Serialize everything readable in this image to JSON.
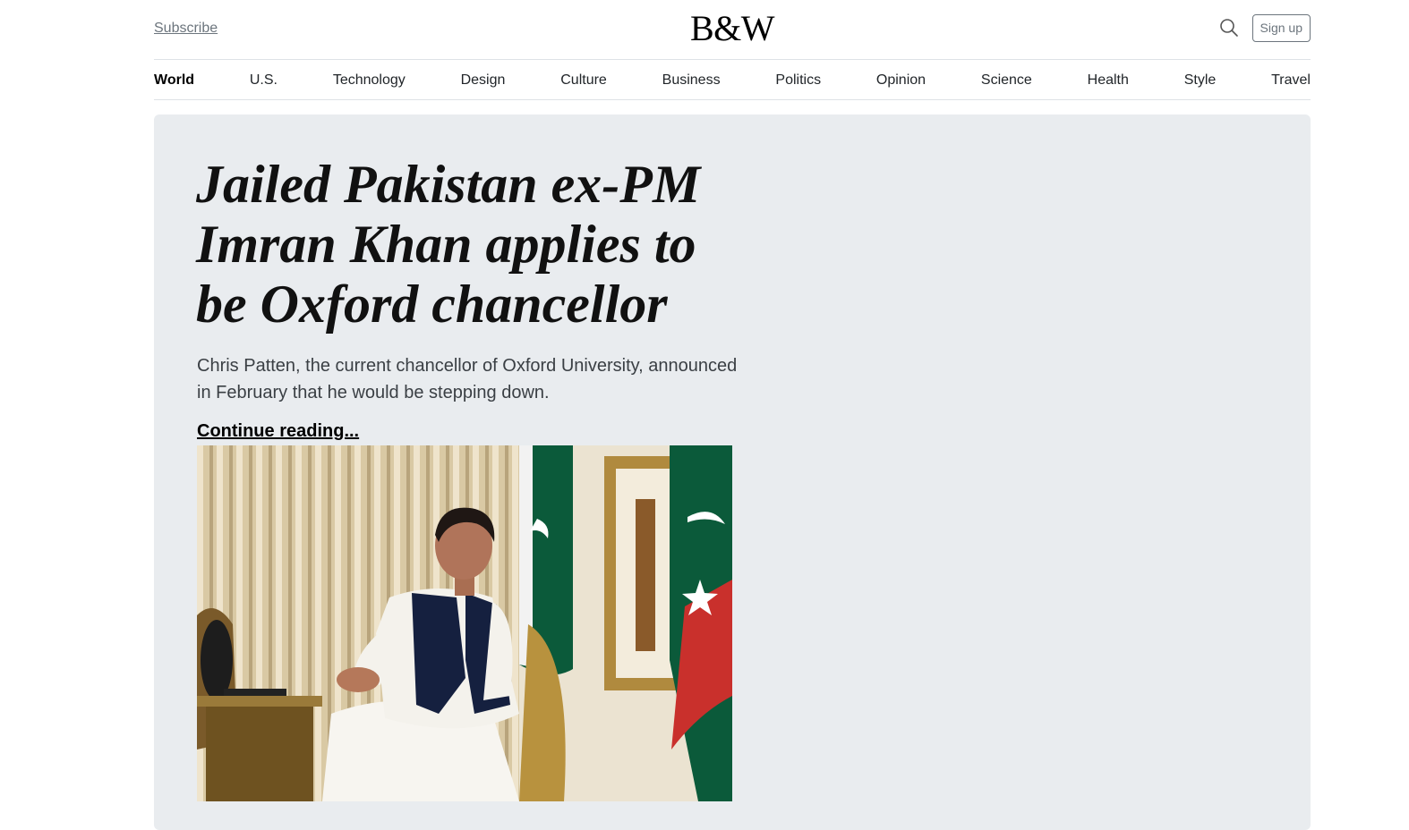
{
  "header": {
    "subscribe_label": "Subscribe",
    "brand": "B&W",
    "signup_label": "Sign up",
    "search_icon": "search-icon"
  },
  "nav": {
    "items": [
      {
        "label": "World",
        "active": true
      },
      {
        "label": "U.S."
      },
      {
        "label": "Technology"
      },
      {
        "label": "Design"
      },
      {
        "label": "Culture"
      },
      {
        "label": "Business"
      },
      {
        "label": "Politics"
      },
      {
        "label": "Opinion"
      },
      {
        "label": "Science"
      },
      {
        "label": "Health"
      },
      {
        "label": "Style"
      },
      {
        "label": "Travel"
      }
    ]
  },
  "hero": {
    "headline": "Jailed Pakistan ex-PM Imran Khan applies to be Oxford chancellor",
    "lede": "Chris Patten, the current chancellor of Oxford University, announced in February that he would be stepping down.",
    "continue_label": "Continue reading...",
    "image_alt": "Imran Khan seated in front of Pakistan flags"
  },
  "colors": {
    "hero_bg": "#e9ecef",
    "border": "#dee2e6",
    "muted": "#6c757d",
    "flag_green": "#0b5a3a"
  }
}
